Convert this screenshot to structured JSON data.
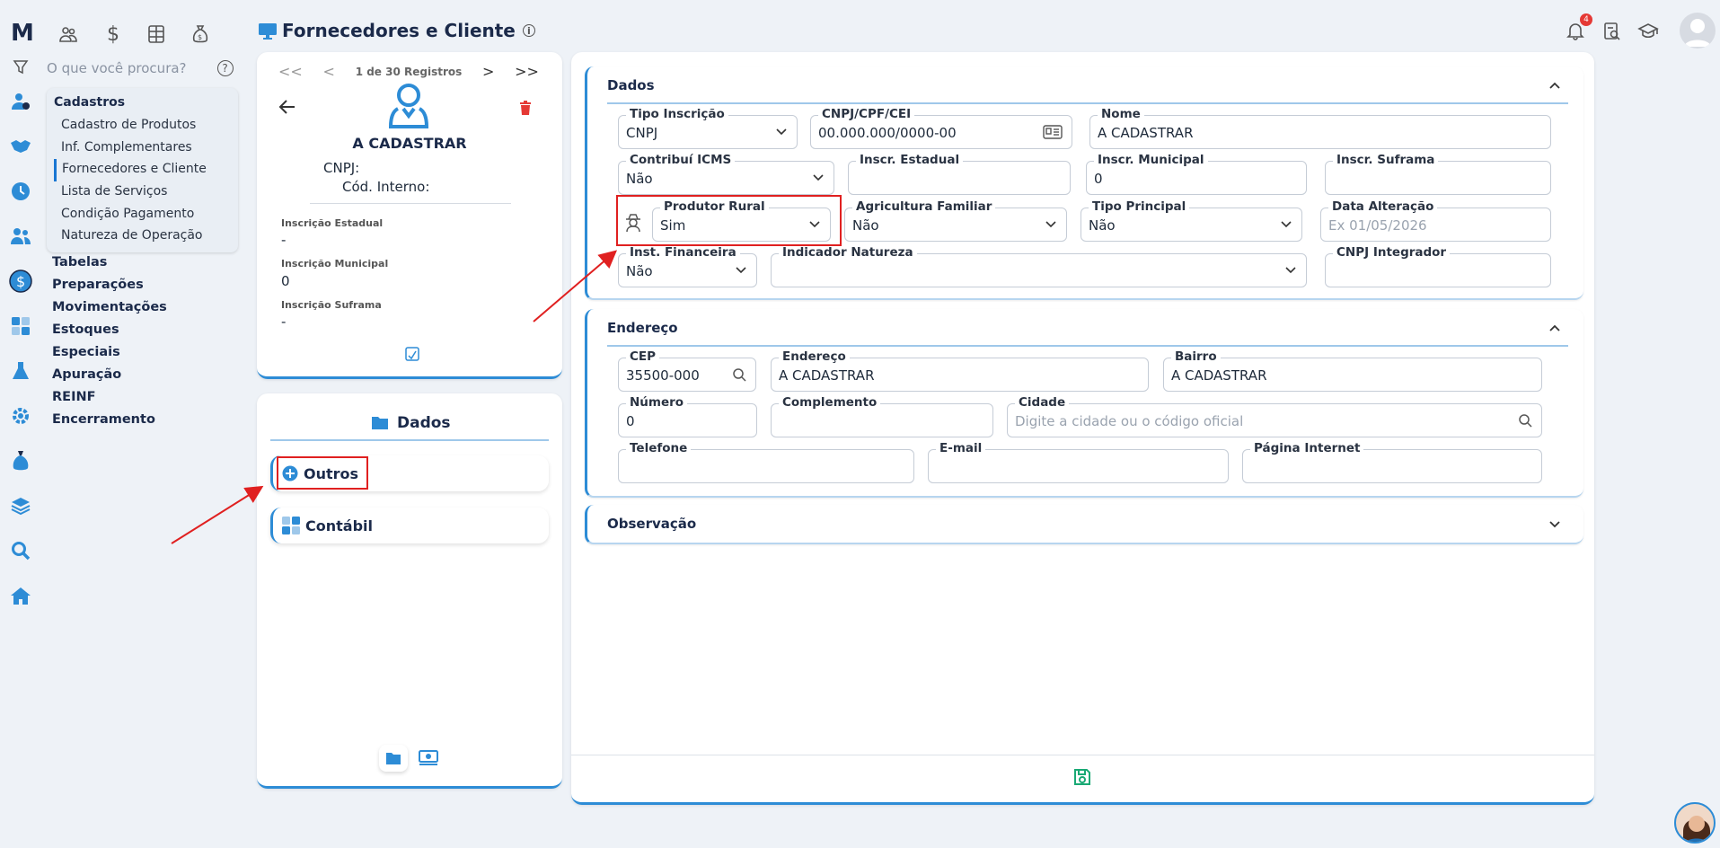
{
  "app": {
    "logo": "M"
  },
  "header": {
    "title": "Fornecedores e Cliente",
    "notification_count": "4"
  },
  "search": {
    "placeholder": "O que você procura?",
    "help": "?"
  },
  "submenu": {
    "title": "Cadastros",
    "items": [
      "Cadastro de Produtos",
      "Inf. Complementares",
      "Fornecedores e Cliente",
      "Lista de Serviços",
      "Condição Pagamento",
      "Natureza de Operação"
    ]
  },
  "mainmenu": [
    "Tabelas",
    "Preparações",
    "Movimentações",
    "Estoques",
    "Especiais",
    "Apuração",
    "REINF",
    "Encerramento"
  ],
  "record": {
    "pager": "1 de 30 Registros",
    "name": "A CADASTRAR",
    "cnpj_label": "CNPJ:",
    "cod_label": "Cód. Interno:",
    "fields": [
      {
        "label": "Inscrição Estadual",
        "value": "-"
      },
      {
        "label": "Inscrição Municipal",
        "value": "0"
      },
      {
        "label": "Inscrição Suframa",
        "value": "-"
      }
    ]
  },
  "tabs_panel": {
    "title": "Dados",
    "tabs": [
      "Outros",
      "Contábil"
    ]
  },
  "dados": {
    "title": "Dados",
    "fields": {
      "tipo_inscricao": {
        "label": "Tipo Inscrição",
        "value": "CNPJ"
      },
      "cnpj": {
        "label": "CNPJ/CPF/CEI",
        "value": "00.000.000/0000-00"
      },
      "nome": {
        "label": "Nome",
        "value": "A CADASTRAR"
      },
      "contribui_icms": {
        "label": "Contribuí ICMS",
        "value": "Não"
      },
      "inscr_estadual": {
        "label": "Inscr. Estadual",
        "value": ""
      },
      "inscr_municipal": {
        "label": "Inscr. Municipal",
        "value": "0"
      },
      "inscr_suframa": {
        "label": "Inscr. Suframa",
        "value": ""
      },
      "produtor_rural": {
        "label": "Produtor Rural",
        "value": "Sim"
      },
      "agricultura_familiar": {
        "label": "Agricultura Familiar",
        "value": "Não"
      },
      "tipo_principal": {
        "label": "Tipo Principal",
        "value": "Não"
      },
      "data_alteracao": {
        "label": "Data Alteração",
        "placeholder": "Ex 01/05/2026"
      },
      "inst_financeira": {
        "label": "Inst. Financeira",
        "value": "Não"
      },
      "indicador_natureza": {
        "label": "Indicador Natureza",
        "value": ""
      },
      "cnpj_integrador": {
        "label": "CNPJ Integrador",
        "value": ""
      }
    }
  },
  "endereco": {
    "title": "Endereço",
    "fields": {
      "cep": {
        "label": "CEP",
        "value": "35500-000"
      },
      "endereco": {
        "label": "Endereço",
        "value": "A CADASTRAR"
      },
      "bairro": {
        "label": "Bairro",
        "value": "A CADASTRAR"
      },
      "numero": {
        "label": "Número",
        "value": "0"
      },
      "complemento": {
        "label": "Complemento",
        "value": ""
      },
      "cidade": {
        "label": "Cidade",
        "placeholder": "Digite a cidade ou o código oficial"
      },
      "telefone": {
        "label": "Telefone",
        "value": ""
      },
      "email": {
        "label": "E-mail",
        "value": ""
      },
      "pagina": {
        "label": "Página Internet",
        "value": ""
      }
    }
  },
  "observacao": {
    "title": "Observação"
  },
  "colors": {
    "accent": "#2d8cd6",
    "danger": "#e53935",
    "annotation": "#e02020",
    "save": "#19a974"
  }
}
